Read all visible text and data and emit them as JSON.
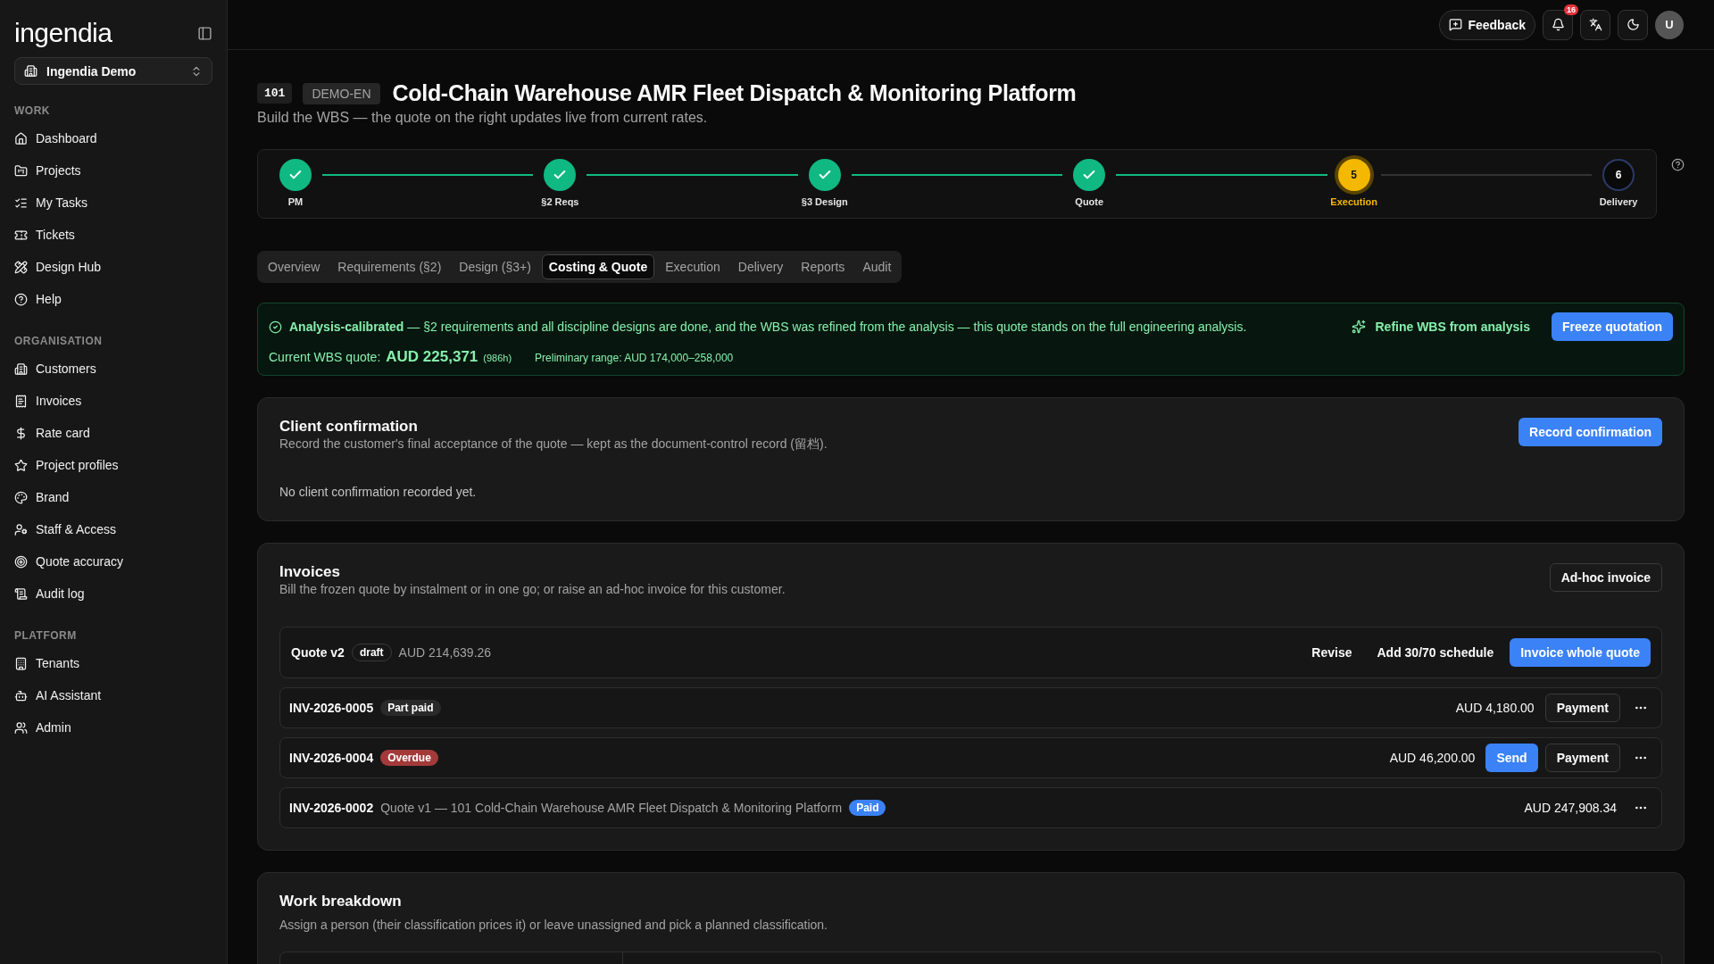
{
  "sidebar": {
    "logo": "ingendia",
    "workspace": "Ingendia Demo",
    "sections": [
      {
        "title": "WORK",
        "items": [
          {
            "label": "Dashboard"
          },
          {
            "label": "Projects"
          },
          {
            "label": "My Tasks"
          },
          {
            "label": "Tickets"
          },
          {
            "label": "Design Hub"
          },
          {
            "label": "Help"
          }
        ]
      },
      {
        "title": "ORGANISATION",
        "items": [
          {
            "label": "Customers"
          },
          {
            "label": "Invoices"
          },
          {
            "label": "Rate card"
          },
          {
            "label": "Project profiles"
          },
          {
            "label": "Brand"
          },
          {
            "label": "Staff & Access"
          },
          {
            "label": "Quote accuracy"
          },
          {
            "label": "Audit log"
          }
        ]
      },
      {
        "title": "PLATFORM",
        "items": [
          {
            "label": "Tenants"
          },
          {
            "label": "AI Assistant"
          },
          {
            "label": "Admin"
          }
        ]
      }
    ]
  },
  "topbar": {
    "feedback": "Feedback",
    "notifications": "16",
    "avatar": "U"
  },
  "project": {
    "number": "101",
    "code": "DEMO-EN",
    "title": "Cold-Chain Warehouse AMR Fleet Dispatch & Monitoring Platform",
    "subtitle": "Build the WBS — the quote on the right updates live from current rates."
  },
  "stepper": [
    {
      "label": "PM",
      "done": true,
      "current": false
    },
    {
      "label": "§2 Reqs",
      "done": true,
      "current": false
    },
    {
      "label": "§3 Design",
      "done": true,
      "current": false
    },
    {
      "label": "Quote",
      "done": true,
      "current": false
    },
    {
      "label": "Execution",
      "number": "5",
      "done": false,
      "current": true
    },
    {
      "label": "Delivery",
      "number": "6",
      "done": false,
      "current": false
    }
  ],
  "tabs": [
    {
      "label": "Overview",
      "selected": false
    },
    {
      "label": "Requirements (§2)",
      "selected": false
    },
    {
      "label": "Design (§3+)",
      "selected": false
    },
    {
      "label": "Costing & Quote",
      "selected": true
    },
    {
      "label": "Execution",
      "selected": false
    },
    {
      "label": "Delivery",
      "selected": false
    },
    {
      "label": "Reports",
      "selected": false
    },
    {
      "label": "Audit",
      "selected": false
    }
  ],
  "banner": {
    "message": "**Analysis-calibrated** — §2 requirements and all discipline designs are done, and the WBS was refined from the analysis — this quote stands on the full engineering analysis.",
    "refine": "Refine WBS from analysis",
    "freeze": "Freeze quotation",
    "quote_label": "Current WBS quote:",
    "quote_value": "AUD 225,371",
    "hours": "(986h)",
    "range": "Preliminary range: AUD 174,000–258,000"
  },
  "client_confirmation": {
    "title": "Client confirmation",
    "description": "Record the customer's final acceptance of the quote — kept as the document-control record (留档).",
    "button": "Record confirmation",
    "empty": "No client confirmation recorded yet."
  },
  "invoices": {
    "title": "Invoices",
    "description": "Bill the frozen quote by instalment or in one go; or raise an ad-hoc invoice for this customer.",
    "button": "Ad-hoc invoice",
    "quote": {
      "name": "Quote v2",
      "badge": "draft",
      "amount": "AUD 214,639.26",
      "actions": [
        {
          "label": "Revise",
          "kind": "ghost"
        },
        {
          "label": "Add 30/70 schedule",
          "kind": "ghost"
        },
        {
          "label": "Invoice whole quote",
          "kind": "primary"
        }
      ]
    },
    "rows": [
      {
        "number": "INV-2026-0005",
        "badge": {
          "text": "Part paid",
          "kind": "neutral"
        },
        "amount": "AUD 4,180.00",
        "actions": [
          {
            "label": "Payment",
            "kind": "outline"
          }
        ]
      },
      {
        "number": "INV-2026-0004",
        "badge": {
          "text": "Overdue",
          "kind": "danger"
        },
        "amount": "AUD 46,200.00",
        "actions": [
          {
            "label": "Send",
            "kind": "primary"
          },
          {
            "label": "Payment",
            "kind": "outline"
          }
        ]
      },
      {
        "number": "INV-2026-0002",
        "description": "Quote v1 — 101 Cold-Chain Warehouse AMR Fleet Dispatch & Monitoring Platform",
        "badge": {
          "text": "Paid",
          "kind": "info"
        },
        "amount": "AUD 247,908.34"
      }
    ]
  },
  "work_breakdown": {
    "title": "Work breakdown",
    "description": "Assign a person (their classification prices it) or leave unassigned and pick a planned classification."
  }
}
